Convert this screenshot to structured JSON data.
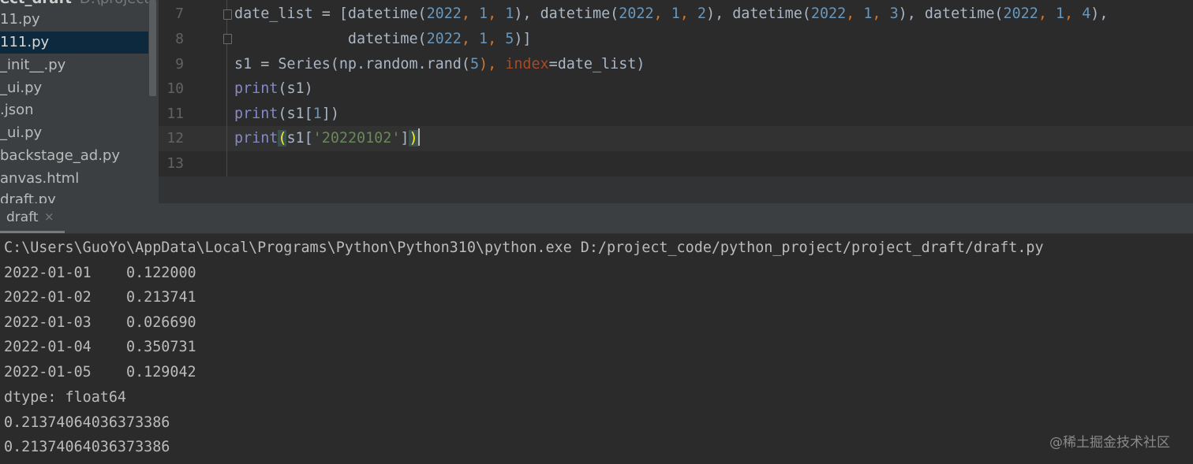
{
  "project": {
    "root_name": "ect_draft",
    "root_path": "D:\\project_co",
    "files": [
      "11.py",
      "111.py",
      "_init__.py",
      "_ui.py",
      ".json",
      "_ui.py",
      "backstage_ad.py",
      "anvas.html",
      "draft.py"
    ],
    "selected_index": 1
  },
  "editor": {
    "line_numbers": [
      "7",
      "8",
      "9",
      "10",
      "11",
      "12",
      "13"
    ],
    "code": {
      "l7": {
        "a": "date_list = [datetime(",
        "n1": "2022",
        "c1": ", ",
        "n2": "1",
        "c2": ", ",
        "n3": "1",
        "b": "), datetime(",
        "n4": "2022",
        "c3": ", ",
        "n5": "1",
        "c4": ", ",
        "n6": "2",
        "c": "), datetime(",
        "n7": "2022",
        "c5": ", ",
        "n8": "1",
        "c6": ", ",
        "n9": "3",
        "d": "), datetime(",
        "n10": "2022",
        "c7": ", ",
        "n11": "1",
        "c8": ", ",
        "n12": "4",
        "e": "),"
      },
      "l8": {
        "a": "             datetime(",
        "n1": "2022",
        "c1": ", ",
        "n2": "1",
        "c2": ", ",
        "n3": "5",
        "b": ")]"
      },
      "l9": {
        "a": "s1 = Series(np.random.rand(",
        "n1": "5",
        "b": "), ",
        "kw": "index",
        "c": "=date_list)"
      },
      "l10": {
        "fn": "print",
        "rest": "(s1)"
      },
      "l11": {
        "fn": "print",
        "a": "(s1[",
        "n1": "1",
        "b": "])"
      },
      "l12": {
        "fn": "print",
        "open": "(",
        "a": "s1[",
        "str": "'20220102'",
        "b": "]",
        "close": ")"
      }
    }
  },
  "run": {
    "tab_label": "draft",
    "tab_close": "×",
    "output": [
      "C:\\Users\\GuoYo\\AppData\\Local\\Programs\\Python\\Python310\\python.exe D:/project_code/python_project/project_draft/draft.py",
      "2022-01-01    0.122000",
      "2022-01-02    0.213741",
      "2022-01-03    0.026690",
      "2022-01-04    0.350731",
      "2022-01-05    0.129042",
      "dtype: float64",
      "0.21374064036373386",
      "0.21374064036373386"
    ]
  },
  "watermark": "@稀土掘金技术社区"
}
